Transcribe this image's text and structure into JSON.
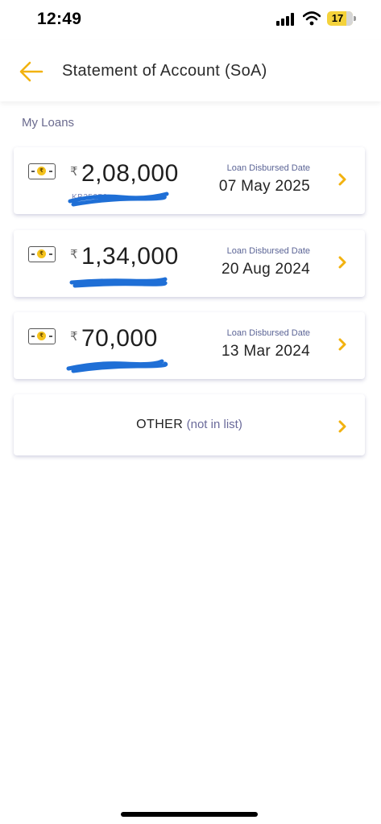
{
  "status_bar": {
    "time": "12:49",
    "battery": "17"
  },
  "header": {
    "title": "Statement of Account (SoA)"
  },
  "section": {
    "label": "My Loans"
  },
  "loans": [
    {
      "currency": "₹",
      "amount": "2,08,000",
      "loan_id": "KB25050",
      "date_label": "Loan Disbursed Date",
      "date": "07 May 2025"
    },
    {
      "currency": "₹",
      "amount": "1,34,000",
      "loan_id": "",
      "date_label": "Loan Disbursed Date",
      "date": "20 Aug 2024"
    },
    {
      "currency": "₹",
      "amount": "70,000",
      "loan_id": "",
      "date_label": "Loan Disbursed Date",
      "date": "13 Mar 2024"
    }
  ],
  "other": {
    "label": "OTHER",
    "sub_label": "(not in list)"
  },
  "colors": {
    "accent": "#f2b20f",
    "scribble": "#1f6fd6",
    "secondary_text": "#6a6a8e"
  },
  "icons": {
    "back": "arrow-left-icon",
    "chevron": "chevron-right-icon",
    "loan": "rupee-card-icon"
  }
}
